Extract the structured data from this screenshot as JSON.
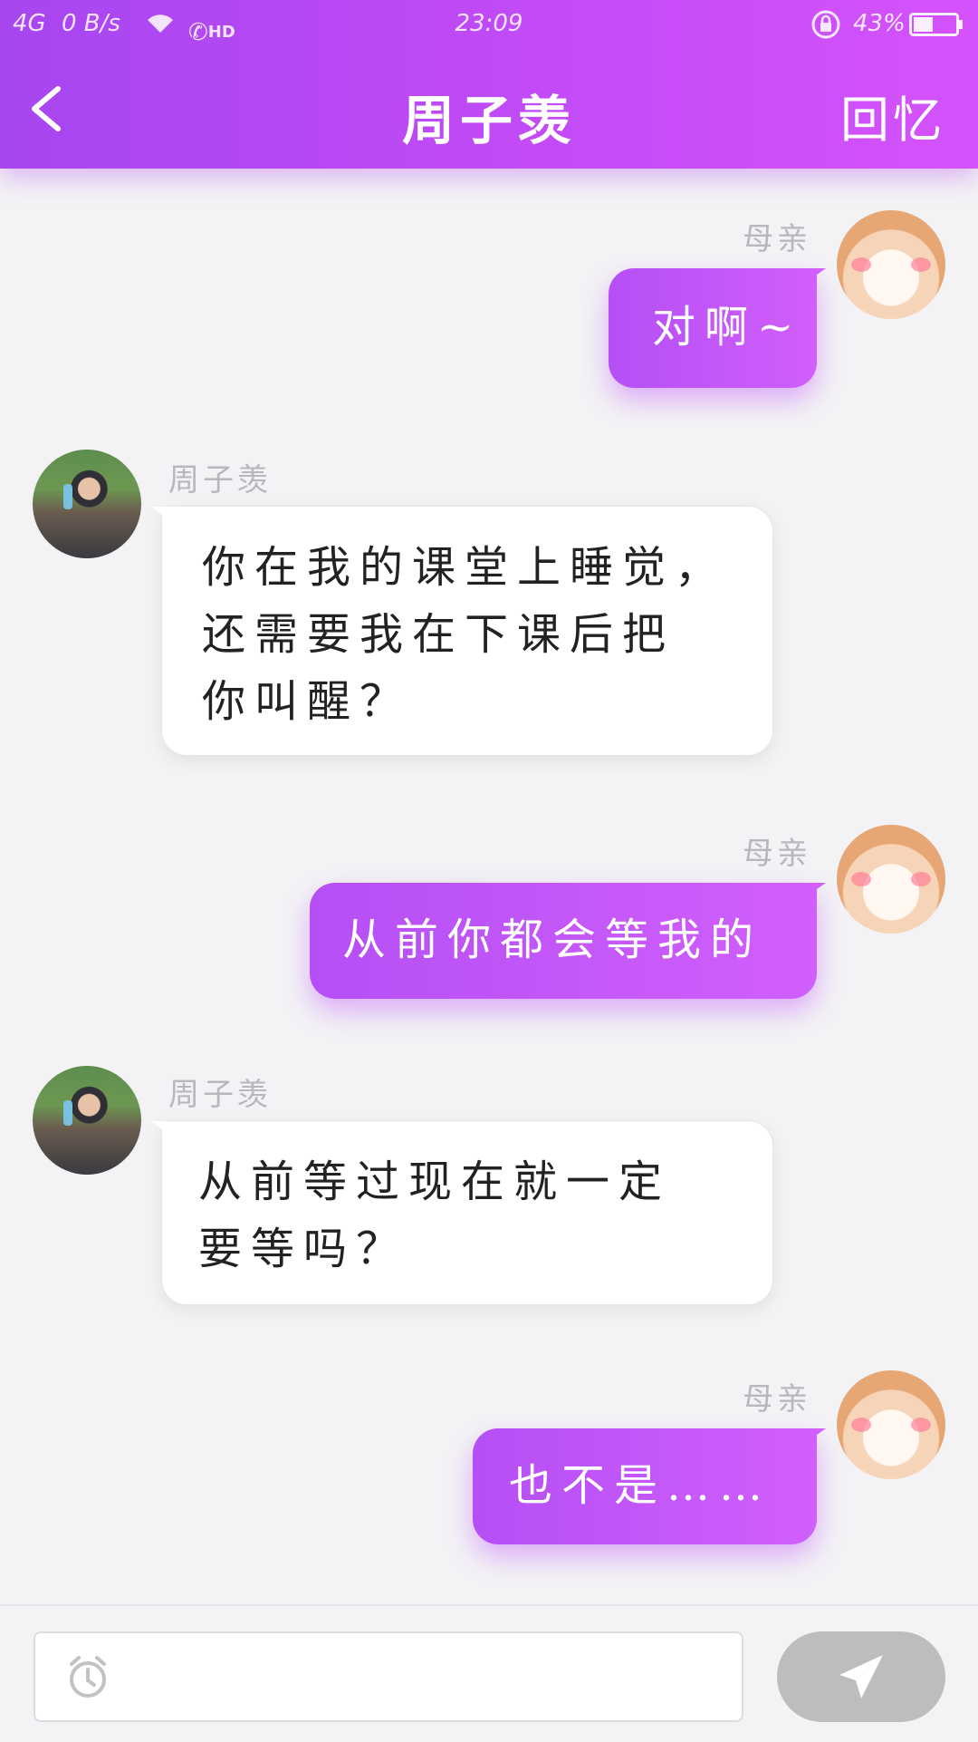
{
  "status_bar": {
    "signal": "4G",
    "net_speed": "0 B/s",
    "hd": "HD",
    "time": "23:09",
    "battery": "43%"
  },
  "header": {
    "title": "周子羡",
    "recall_label": "回忆"
  },
  "messages": [
    {
      "side": "mine",
      "sender": "母亲",
      "text": "对啊~"
    },
    {
      "side": "theirs",
      "sender": "周子羡",
      "text": "你在我的课堂上睡觉，\n还需要我在下课后把\n你叫醒？"
    },
    {
      "side": "mine",
      "sender": "母亲",
      "text": "从前你都会等我的"
    },
    {
      "side": "theirs",
      "sender": "周子羡",
      "text": "从前等过现在就一定\n要等吗？"
    },
    {
      "side": "mine",
      "sender": "母亲",
      "text": "也不是……"
    }
  ],
  "input": {
    "placeholder": ""
  },
  "icons": {
    "back": "chevron-left-icon",
    "alarm": "alarm-clock-icon",
    "send": "paper-plane-icon"
  },
  "colors": {
    "accent_start": "#a746f0",
    "accent_end": "#d452fb",
    "send_button": "#bdbdc0"
  }
}
